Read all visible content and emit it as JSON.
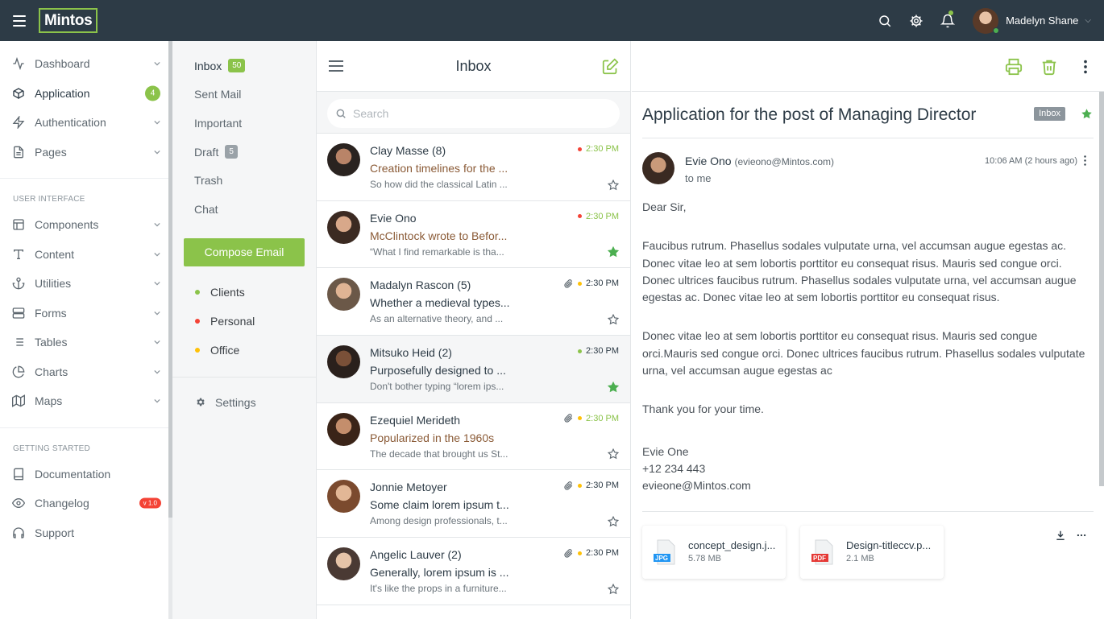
{
  "app": {
    "logo": "Mintos"
  },
  "topbar": {
    "user_name": "Madelyn Shane"
  },
  "sidebar": {
    "items": [
      {
        "label": "Dashboard",
        "icon": "activity-icon",
        "chevron": true
      },
      {
        "label": "Application",
        "icon": "box-icon",
        "badge": "4",
        "active": true
      },
      {
        "label": "Authentication",
        "icon": "zap-icon",
        "chevron": true
      },
      {
        "label": "Pages",
        "icon": "file-icon",
        "chevron": true
      }
    ],
    "section_ui": "USER INTERFACE",
    "ui_items": [
      {
        "label": "Components",
        "icon": "layout-icon"
      },
      {
        "label": "Content",
        "icon": "type-icon"
      },
      {
        "label": "Utilities",
        "icon": "anchor-icon"
      },
      {
        "label": "Forms",
        "icon": "server-icon"
      },
      {
        "label": "Tables",
        "icon": "list-icon"
      },
      {
        "label": "Charts",
        "icon": "pie-chart-icon"
      },
      {
        "label": "Maps",
        "icon": "map-icon"
      }
    ],
    "section_started": "GETTING STARTED",
    "started_items": [
      {
        "label": "Documentation",
        "icon": "book-icon"
      },
      {
        "label": "Changelog",
        "icon": "eye-icon",
        "badge": "v 1.0"
      },
      {
        "label": "Support",
        "icon": "headphones-icon"
      }
    ]
  },
  "folders": {
    "items": [
      {
        "label": "Inbox",
        "badge": "50"
      },
      {
        "label": "Sent Mail"
      },
      {
        "label": "Important"
      },
      {
        "label": "Draft",
        "badge": "5"
      },
      {
        "label": "Trash"
      },
      {
        "label": "Chat"
      }
    ],
    "compose_label": "Compose Email",
    "labels": [
      {
        "label": "Clients",
        "color": "#8bc34a"
      },
      {
        "label": "Personal",
        "color": "#f44336"
      },
      {
        "label": "Office",
        "color": "#ffc107"
      }
    ],
    "settings_label": "Settings"
  },
  "list": {
    "title": "Inbox",
    "search_placeholder": "Search",
    "messages": [
      {
        "from": "Clay Masse (8)",
        "subject": "Creation timelines for the ...",
        "preview": "So how did the classical Latin ...",
        "time": "2:30 PM",
        "dot_color": "#f44336",
        "time_green": true,
        "subject_brown": true,
        "starred": false,
        "attachment": false
      },
      {
        "from": "Evie Ono",
        "subject": "McClintock wrote to Befor...",
        "preview": "“What I find remarkable is tha...",
        "time": "2:30 PM",
        "dot_color": "#f44336",
        "time_green": true,
        "subject_brown": true,
        "starred": true,
        "attachment": false
      },
      {
        "from": "Madalyn Rascon (5)",
        "subject": "Whether a medieval types...",
        "preview": "As an alternative theory, and ...",
        "time": "2:30 PM",
        "dot_color": "#ffc107",
        "time_green": false,
        "subject_brown": false,
        "starred": false,
        "attachment": true
      },
      {
        "from": "Mitsuko Heid (2)",
        "subject": "Purposefully designed to ...",
        "preview": "Don't bother typing “lorem ips...",
        "time": "2:30 PM",
        "dot_color": "#8bc34a",
        "time_green": false,
        "subject_brown": false,
        "starred": true,
        "attachment": false,
        "selected": true
      },
      {
        "from": "Ezequiel Merideth",
        "subject": "Popularized in the 1960s",
        "preview": "The decade that brought us St...",
        "time": "2:30 PM",
        "dot_color": "#ffc107",
        "time_green": true,
        "subject_brown": true,
        "starred": false,
        "attachment": true
      },
      {
        "from": "Jonnie Metoyer",
        "subject": "Some claim lorem ipsum t...",
        "preview": "Among design professionals, t...",
        "time": "2:30 PM",
        "dot_color": "#ffc107",
        "time_green": false,
        "subject_brown": false,
        "starred": false,
        "attachment": true
      },
      {
        "from": "Angelic Lauver (2)",
        "subject": "Generally, lorem ipsum is ...",
        "preview": "It's like the props in a furniture...",
        "time": "2:30 PM",
        "dot_color": "#ffc107",
        "time_green": false,
        "subject_brown": false,
        "starred": false,
        "attachment": true
      }
    ]
  },
  "reader": {
    "subject": "Application for the post of Managing Director",
    "tag": "Inbox",
    "sender_name": "Evie Ono",
    "sender_email": "(evieono@Mintos.com)",
    "to": "to me",
    "time": "10:06 AM (2 hours ago)",
    "greeting": "Dear Sir,",
    "para1": "Faucibus rutrum. Phasellus sodales vulputate urna, vel accumsan augue egestas ac. Donec vitae leo at sem lobortis porttitor eu consequat risus. Mauris sed congue orci. Donec ultrices faucibus rutrum. Phasellus sodales vulputate urna, vel accumsan augue egestas ac. Donec vitae leo at sem lobortis porttitor eu consequat risus.",
    "para2": "Donec vitae leo at sem lobortis porttitor eu consequat risus. Mauris sed congue orci.Mauris sed congue orci. Donec ultrices faucibus rutrum. Phasellus sodales vulputate urna, vel accumsan augue egestas ac",
    "thanks": "Thank you for your time.",
    "sig_name": "Evie One",
    "sig_phone": "+12 234 443",
    "sig_email": "evieone@Mintos.com",
    "attachments": [
      {
        "name": "concept_design.j...",
        "size": "5.78 MB",
        "type": "JPG",
        "color": "#2196f3"
      },
      {
        "name": "Design-titleccv.p...",
        "size": "2.1 MB",
        "type": "PDF",
        "color": "#e53935"
      }
    ]
  },
  "colors": {
    "accent": "#8bc34a",
    "topbar": "#2d3b46"
  }
}
